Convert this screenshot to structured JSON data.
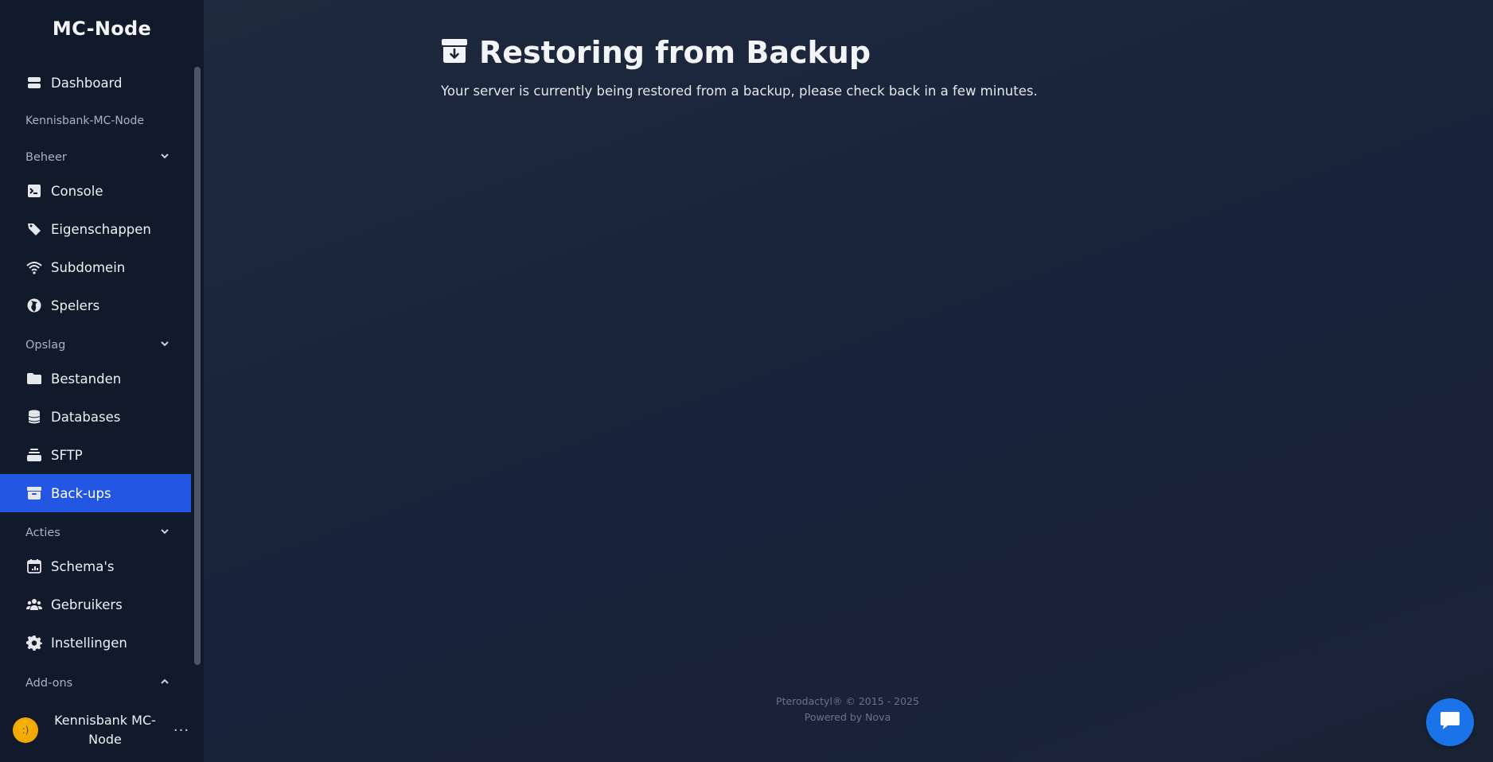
{
  "sidebar": {
    "brand": "MC-Node",
    "dashboard": "Dashboard",
    "server_name": "Kennisbank-MC-Node",
    "sections": {
      "beheer": "Beheer",
      "opslag": "Opslag",
      "acties": "Acties",
      "addons": "Add-ons"
    },
    "items": {
      "console": "Console",
      "eigenschappen": "Eigenschappen",
      "subdomein": "Subdomein",
      "spelers": "Spelers",
      "bestanden": "Bestanden",
      "databases": "Databases",
      "sftp": "SFTP",
      "backups": "Back-ups",
      "schemas": "Schema's",
      "gebruikers": "Gebruikers",
      "instellingen": "Instellingen"
    },
    "active_item": "backups",
    "user": {
      "name": "Kennisbank MC-Node",
      "more": "···"
    }
  },
  "main": {
    "title": "Restoring from Backup",
    "description": "Your server is currently being restored from a backup, please check back in a few minutes."
  },
  "footer": {
    "line1": "Pterodactyl® © 2015 - 2025",
    "line2": "Powered by Nova"
  },
  "colors": {
    "accent": "#2357e3",
    "sidebar_bg": "#111a2b",
    "chat_button": "#1a73e8"
  }
}
